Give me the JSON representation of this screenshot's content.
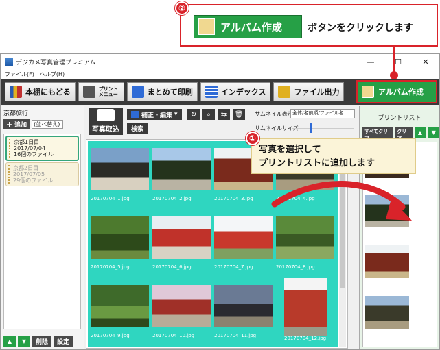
{
  "callout_top": {
    "number": "②",
    "button_label": "アルバム作成",
    "text": "ボタンをクリックします"
  },
  "callout_mid": {
    "number": "①",
    "line1": "写真を選択して",
    "line2": "プリントリストに追加します"
  },
  "window": {
    "title": "デジカメ写真管理プレミアム",
    "minimize": "—",
    "maximize": "☐",
    "close": "✕"
  },
  "menu": {
    "file": "ファイル(F)",
    "help": "ヘルプ(H)"
  },
  "toolbar": {
    "back": "本棚にもどる",
    "print_small": "プリント メニュー",
    "print_all": "まとめて印刷",
    "index": "インデックス",
    "file_output": "ファイル出力",
    "album": "アルバム作成"
  },
  "left": {
    "folder": "京都旅行",
    "add": "追加",
    "sort": "(並べ替え)",
    "days": [
      {
        "title": "京都1日目",
        "date": "2017/07/04",
        "count": "16個のファイル"
      },
      {
        "title": "京都2日目",
        "date": "2017/07/05",
        "count": "29個のファイル"
      }
    ],
    "delete": "削除",
    "settings": "設定"
  },
  "center": {
    "import": "写真取込",
    "edit": "補正・編集",
    "search": "検索",
    "thumb_display_label": "サムネイル表示",
    "thumb_display_value": "全体/名前順/ファイル名",
    "thumb_size_label": "サムネイルサイズ",
    "thumb_size_level": 0.3,
    "files": [
      "20170704_1.jpg",
      "20170704_2.jpg",
      "20170704_3.jpg",
      "20170704_4.jpg",
      "20170704_5.jpg",
      "20170704_6.jpg",
      "20170704_7.jpg",
      "20170704_8.jpg",
      "20170704_9.jpg",
      "20170704_10.jpg",
      "20170704_11.jpg",
      "20170704_12.jpg"
    ]
  },
  "right": {
    "title": "プリントリスト",
    "select_all": "すべてクリア",
    "clear": "クリア"
  },
  "colors": {
    "accent_green": "#26a046",
    "callout_red": "#d9232a",
    "grid_bg": "#2fd6c0"
  }
}
